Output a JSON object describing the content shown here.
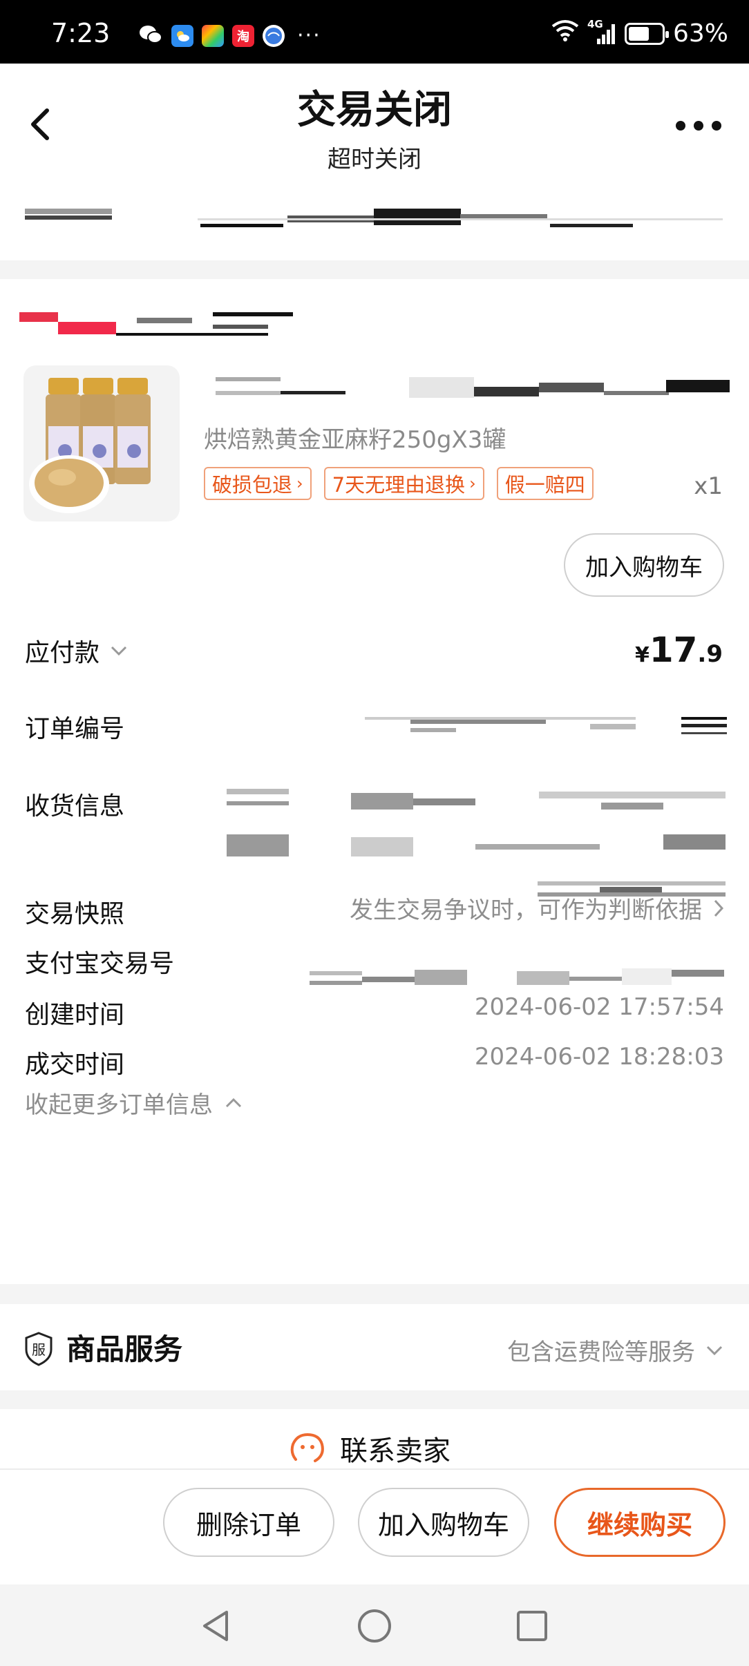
{
  "status_bar": {
    "time": "7:23",
    "network": "4G",
    "battery": "63%",
    "battery_level": 0.63,
    "overflow": "···",
    "app_icons": [
      "wechat-icon",
      "weather-icon",
      "colorful-app-icon",
      "taobao-icon",
      "browser-icon"
    ],
    "taobao_glyph": "淘"
  },
  "header": {
    "title": "交易关闭",
    "subtitle": "超时关闭"
  },
  "product": {
    "title": "烘焙熟黄金亚麻籽250gX3罐",
    "tags": [
      "破损包退",
      "7天无理由退换",
      "假一赔四"
    ],
    "quantity": "x1",
    "add_cart_label": "加入购物车"
  },
  "order": {
    "amount_label": "应付款",
    "price": {
      "currency": "¥",
      "integer": "17",
      "decimal": ".9"
    },
    "order_no_label": "订单编号",
    "shipping_label": "收货信息",
    "snapshot_label": "交易快照",
    "snapshot_value": "发生交易争议时，可作为判断依据",
    "alipay_label": "支付宝交易号",
    "created_label": "创建时间",
    "created_value": "2024-06-02 17:57:54",
    "deal_label": "成交时间",
    "deal_value": "2024-06-02 18:28:03",
    "collapse_label": "收起更多订单信息"
  },
  "services": {
    "icon_glyph": "服",
    "title": "商品服务",
    "value": "包含运费险等服务"
  },
  "contact": {
    "label": "联系卖家"
  },
  "actions": {
    "delete": "删除订单",
    "add_cart": "加入购物车",
    "buy_again": "继续购买"
  },
  "colors": {
    "accent": "#e8561a",
    "tag_border": "#f0a17a",
    "muted_text": "#8d8d8d",
    "background": "#f4f4f4"
  }
}
